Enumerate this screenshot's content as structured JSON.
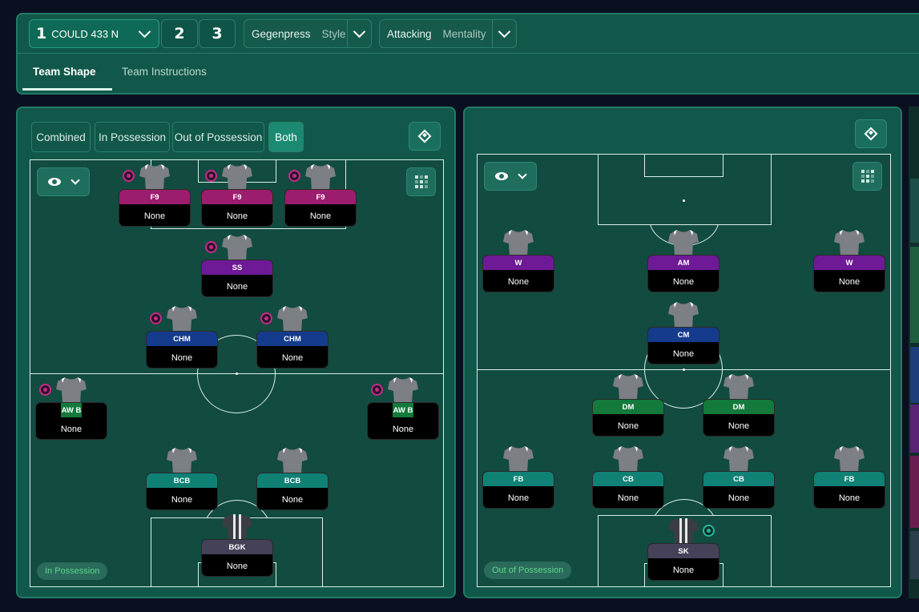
{
  "tactic": {
    "slot_number": "1",
    "name": "COULD 433 N",
    "other_slots": [
      "2",
      "3"
    ],
    "style_value": "Gegenpress",
    "style_label": "Style",
    "mentality_value": "Attacking",
    "mentality_label": "Mentality"
  },
  "tabs": [
    "Team Shape",
    "Team Instructions"
  ],
  "left_panel": {
    "phase_buttons": [
      "Combined",
      "In Possession",
      "Out of Possession",
      "Both"
    ],
    "selected_phase": "Both",
    "phase_tag": "In Possession",
    "players": [
      {
        "role": "F9",
        "name": "None",
        "badge": true
      },
      {
        "role": "F9",
        "name": "None",
        "badge": true
      },
      {
        "role": "F9",
        "name": "None",
        "badge": true
      },
      {
        "role": "SS",
        "name": "None",
        "badge": true
      },
      {
        "role": "CHM",
        "name": "None",
        "badge": true
      },
      {
        "role": "CHM",
        "name": "None",
        "badge": true
      },
      {
        "role": "AW B",
        "name": "None",
        "badge": true
      },
      {
        "role": "AW B",
        "name": "None",
        "badge": true
      },
      {
        "role": "BCB",
        "name": "None",
        "badge": false
      },
      {
        "role": "BCB",
        "name": "None",
        "badge": false
      },
      {
        "role": "BGK",
        "name": "None",
        "badge": false
      }
    ]
  },
  "right_panel": {
    "phase_tag": "Out of Possession",
    "players": [
      {
        "role": "W",
        "name": "None"
      },
      {
        "role": "AM",
        "name": "None"
      },
      {
        "role": "W",
        "name": "None"
      },
      {
        "role": "CM",
        "name": "None"
      },
      {
        "role": "DM",
        "name": "None"
      },
      {
        "role": "DM",
        "name": "None"
      },
      {
        "role": "FB",
        "name": "None"
      },
      {
        "role": "CB",
        "name": "None"
      },
      {
        "role": "CB",
        "name": "None"
      },
      {
        "role": "FB",
        "name": "None"
      },
      {
        "role": "SK",
        "name": "None",
        "badge": true
      }
    ]
  },
  "colors": {
    "panel_bg": "#11584a",
    "pitch_bg": "#124b40",
    "accent": "#1c8a72",
    "f9": "#9c1c6e",
    "ss": "#6e1a96",
    "chm": "#153c8c",
    "awb": "#137a3c",
    "bcb": "#108175",
    "gk": "#444158"
  },
  "icons": [
    "chevron-down-icon",
    "eye-icon",
    "grid-icon",
    "diamond-icon",
    "shirt-icon"
  ]
}
